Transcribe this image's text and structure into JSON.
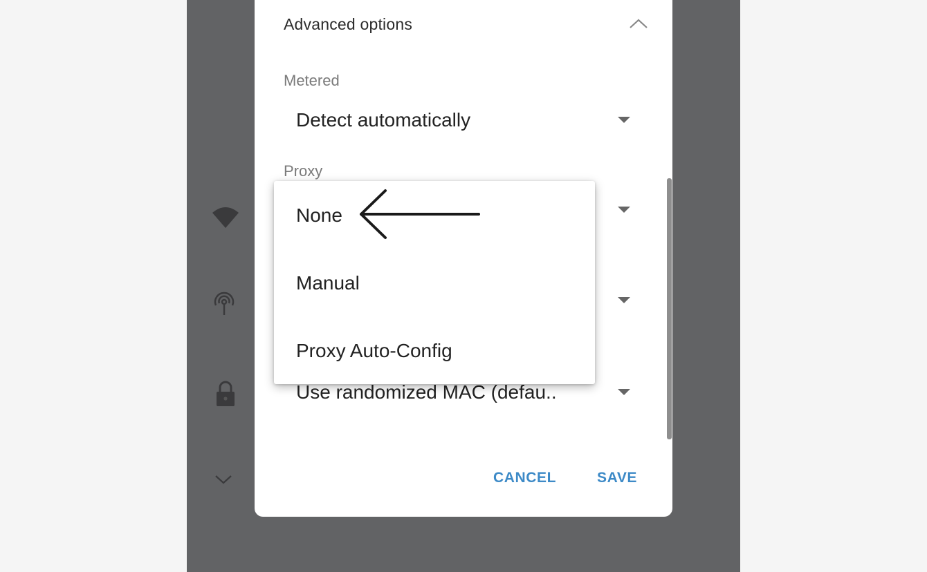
{
  "dialog": {
    "section_header": "Advanced options",
    "metered": {
      "label": "Metered",
      "value": "Detect automatically"
    },
    "proxy": {
      "label": "Proxy"
    },
    "privacy": {
      "value": "Use randomized MAC (defau.."
    },
    "buttons": {
      "cancel": "CANCEL",
      "save": "SAVE"
    }
  },
  "proxy_menu": {
    "options": [
      "None",
      "Manual",
      "Proxy Auto-Config"
    ]
  },
  "icons": {
    "section_toggle": "chevron-up-icon",
    "dropdown": "caret-down-icon",
    "background": [
      "wifi-icon",
      "antenna-icon",
      "lock-icon",
      "chevron-down-icon"
    ],
    "annotation": "left-arrow-icon"
  },
  "colors": {
    "accent": "#3d8ac7",
    "overlay": "#626365",
    "dialog_bg": "#ffffff"
  }
}
